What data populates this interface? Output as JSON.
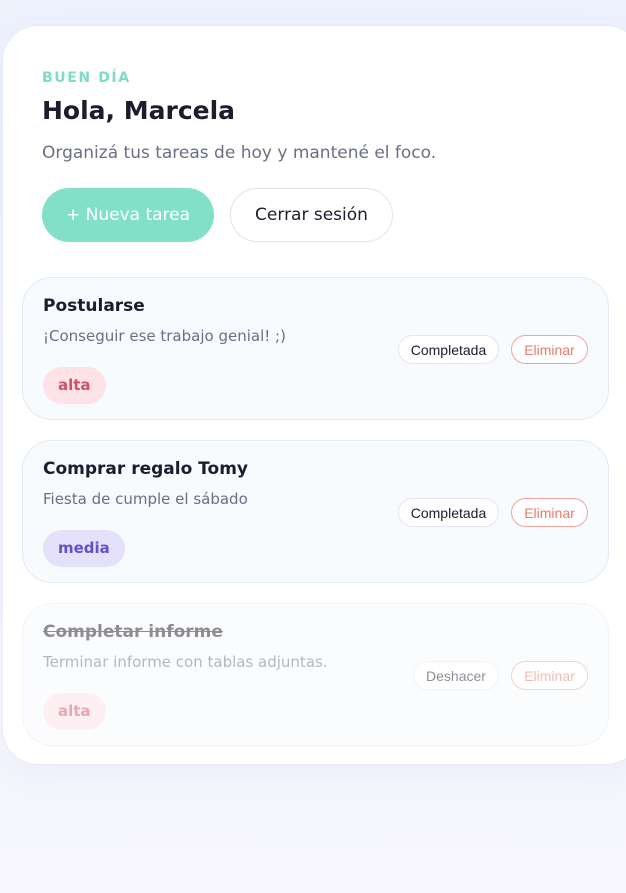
{
  "header": {
    "greeting": "BUEN DÍA",
    "title": "Hola, Marcela",
    "subtitle": "Organizá tus tareas de hoy y mantené el foco."
  },
  "actions": {
    "new_task": "+ Nueva tarea",
    "logout": "Cerrar sesión"
  },
  "tasks": [
    {
      "title": "Postularse",
      "description": "¡Conseguir ese trabajo genial! ;)",
      "priority": "alta",
      "completed": false,
      "toggle_label": "Completada",
      "delete_label": "Eliminar"
    },
    {
      "title": "Comprar regalo Tomy",
      "description": "Fiesta de cumple el sábado",
      "priority": "media",
      "completed": false,
      "toggle_label": "Completada",
      "delete_label": "Eliminar"
    },
    {
      "title": "Completar informe",
      "description": "Terminar informe con tablas adjuntas.",
      "priority": "alta",
      "completed": true,
      "toggle_label": "Deshacer",
      "delete_label": "Eliminar"
    }
  ],
  "colors": {
    "accent": "#82e0c9",
    "priority_alta": "#d24f68",
    "priority_media": "#6650c8",
    "delete": "#ec7a6b"
  }
}
